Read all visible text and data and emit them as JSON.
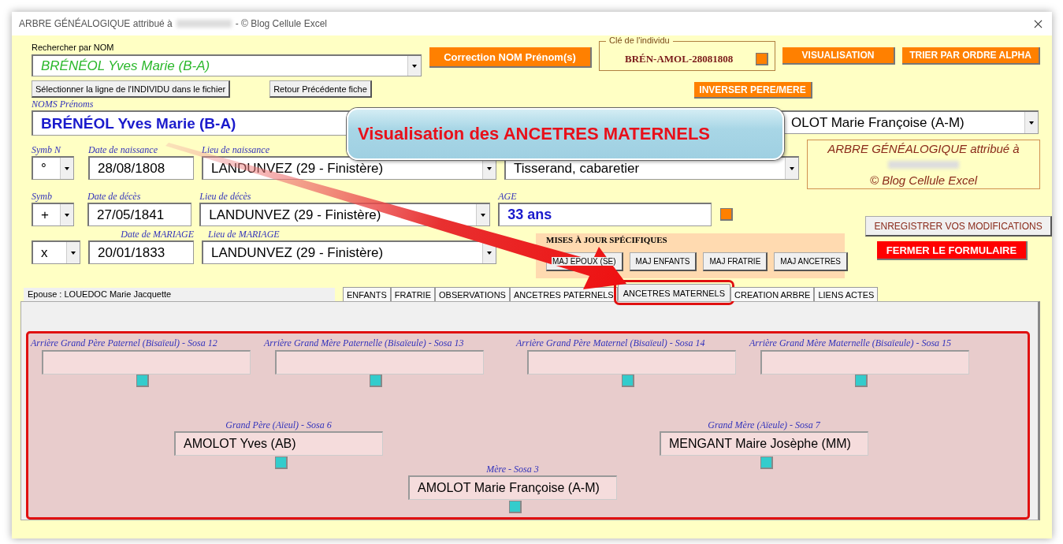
{
  "window": {
    "title": "ARBRE GÉNÉALOGIQUE attribué à",
    "title_suffix": "- © Blog Cellule Excel"
  },
  "search": {
    "label": "Rechercher par NOM",
    "value": "BRÉNÉOL Yves Marie (B-A)"
  },
  "search_buttons": [
    "Sélectionner la ligne de l'INDIVIDU  dans le fichier",
    "Retour Précédente fiche"
  ],
  "correction_button": "Correction NOM Prénom(s)",
  "key": {
    "label": "Clé de l'individu",
    "value": "BRÉN-AMOL-28081808"
  },
  "top_buttons": [
    "VISUALISATION",
    "TRIER PAR ORDRE ALPHA"
  ],
  "swap_button": "INVERSER PERE/MERE",
  "names": {
    "label": "NOMS Prénoms",
    "value": "BRÉNÉOL Yves Marie (B-A)"
  },
  "spouse_field": {
    "value": "OLOT Marie Françoise (A-M)"
  },
  "callout": "Visualisation des ANCETRES MATERNELS",
  "rows": [
    {
      "symb_label": "Symb N",
      "symb": "°",
      "date_label": "Date de naissance",
      "date": "28/08/1808",
      "place_label": "Lieu de naissance",
      "place": "LANDUNVEZ (29 - Finistère)"
    },
    {
      "symb_label": "Symb",
      "symb": "+",
      "date_label": "Date de décès",
      "date": "27/05/1841",
      "place_label": "Lieu de décès",
      "place": "LANDUNVEZ (29 - Finistère)"
    },
    {
      "symb": "x",
      "date_label": "Date de MARIAGE",
      "date": "20/01/1833",
      "place_label": "Lieu de MARIAGE",
      "place": "LANDUNVEZ (29 - Finistère)"
    }
  ],
  "occupation": {
    "value": "Tisserand, cabaretier"
  },
  "age": {
    "label": "AGE",
    "value": "33 ans"
  },
  "info_box": {
    "line1": "ARBRE GÉNÉALOGIQUE attribué à",
    "line2": "© Blog Cellule Excel"
  },
  "save_button": "ENREGISTRER VOS MODIFICATIONS",
  "close_form_button": "FERMER LE FORMULAIRE",
  "updates": {
    "title": "MISES À JOUR SPÉCIFIQUES",
    "buttons": [
      "MAJ EPOUX (SE)",
      "MAJ ENFANTS",
      "MAJ FRATRIE",
      "MAJ ANCETRES"
    ]
  },
  "spouse_tab_label": "Epouse : LOUEDOC Marie Jacquette",
  "tabs": [
    {
      "label": "ENFANTS",
      "selected": false
    },
    {
      "label": "FRATRIE",
      "selected": false
    },
    {
      "label": "OBSERVATIONS",
      "selected": false
    },
    {
      "label": "ANCETRES PATERNELS",
      "selected": false
    },
    {
      "label": "ANCETRES MATERNELS",
      "selected": true
    },
    {
      "label": "CREATION ARBRE",
      "selected": false
    },
    {
      "label": "LIENS ACTES",
      "selected": false
    }
  ],
  "great_grandparents": [
    {
      "label": "Arrière Grand Père Paternel (Bisaïeul) - Sosa 12"
    },
    {
      "label": "Arrière Grand Mère Paternelle (Bisaïeule) - Sosa 13"
    },
    {
      "label": "Arrière Grand Père Maternel (Bisaïeul) - Sosa 14"
    },
    {
      "label": "Arrière Grand Mère Maternelle (Bisaïeule) - Sosa 15"
    }
  ],
  "grandparents": [
    {
      "label": "Grand Père (Aïeul) - Sosa 6",
      "value": "AMOLOT Yves (AB)"
    },
    {
      "label": "Grand Mère (Aïeule) - Sosa 7",
      "value": "MENGANT Maire Josèphe (MM)"
    }
  ],
  "mother": {
    "label": "Mère - Sosa 3",
    "value": "AMOLOT Marie Françoise (A-M)"
  }
}
